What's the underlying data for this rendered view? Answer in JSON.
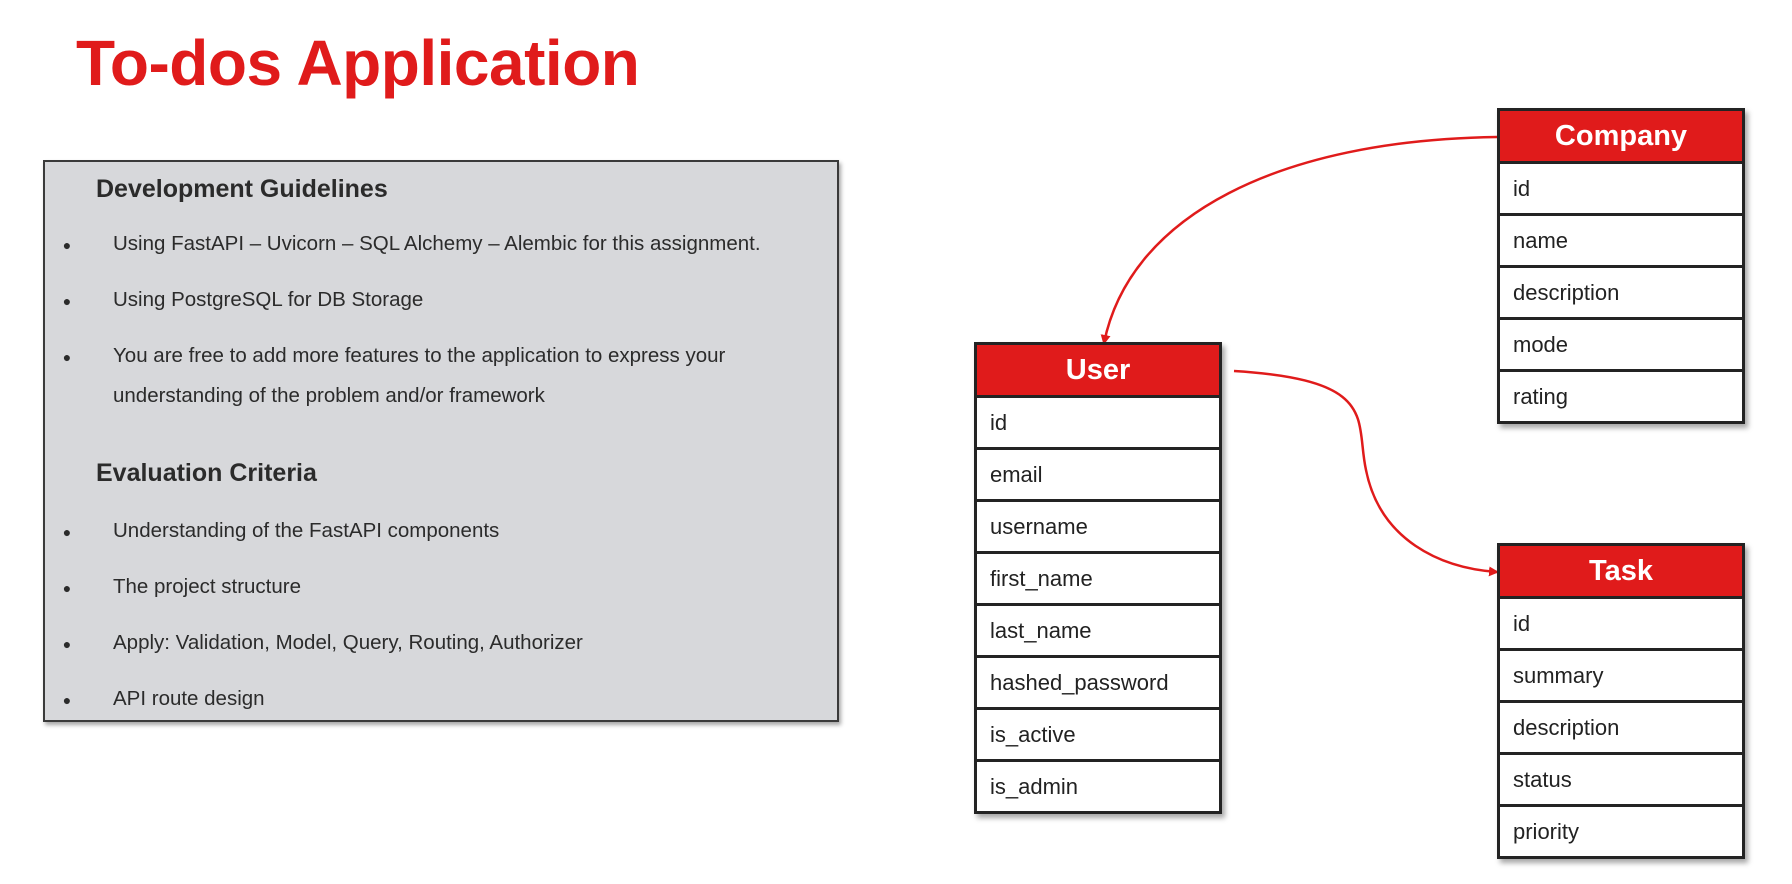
{
  "title": "To-dos Application",
  "accent_color": "#e01b1b",
  "panel": {
    "sections": [
      {
        "heading": "Development Guidelines",
        "items": [
          "Using FastAPI – Uvicorn – SQL Alchemy – Alembic for this assignment.",
          "Using PostgreSQL for DB Storage",
          "You are free to add more features to the application to express your understanding of the problem and/or framework"
        ]
      },
      {
        "heading": "Evaluation Criteria",
        "items": [
          "Understanding of the FastAPI components",
          "The project structure",
          "Apply: Validation, Model, Query, Routing, Authorizer",
          "API route design"
        ]
      }
    ]
  },
  "entities": {
    "company": {
      "name": "Company",
      "fields": [
        "id",
        "name",
        "description",
        "mode",
        "rating"
      ]
    },
    "user": {
      "name": "User",
      "fields": [
        "id",
        "email",
        "username",
        "first_name",
        "last_name",
        "hashed_password",
        "is_active",
        "is_admin"
      ]
    },
    "task": {
      "name": "Task",
      "fields": [
        "id",
        "summary",
        "description",
        "status",
        "priority"
      ]
    }
  }
}
